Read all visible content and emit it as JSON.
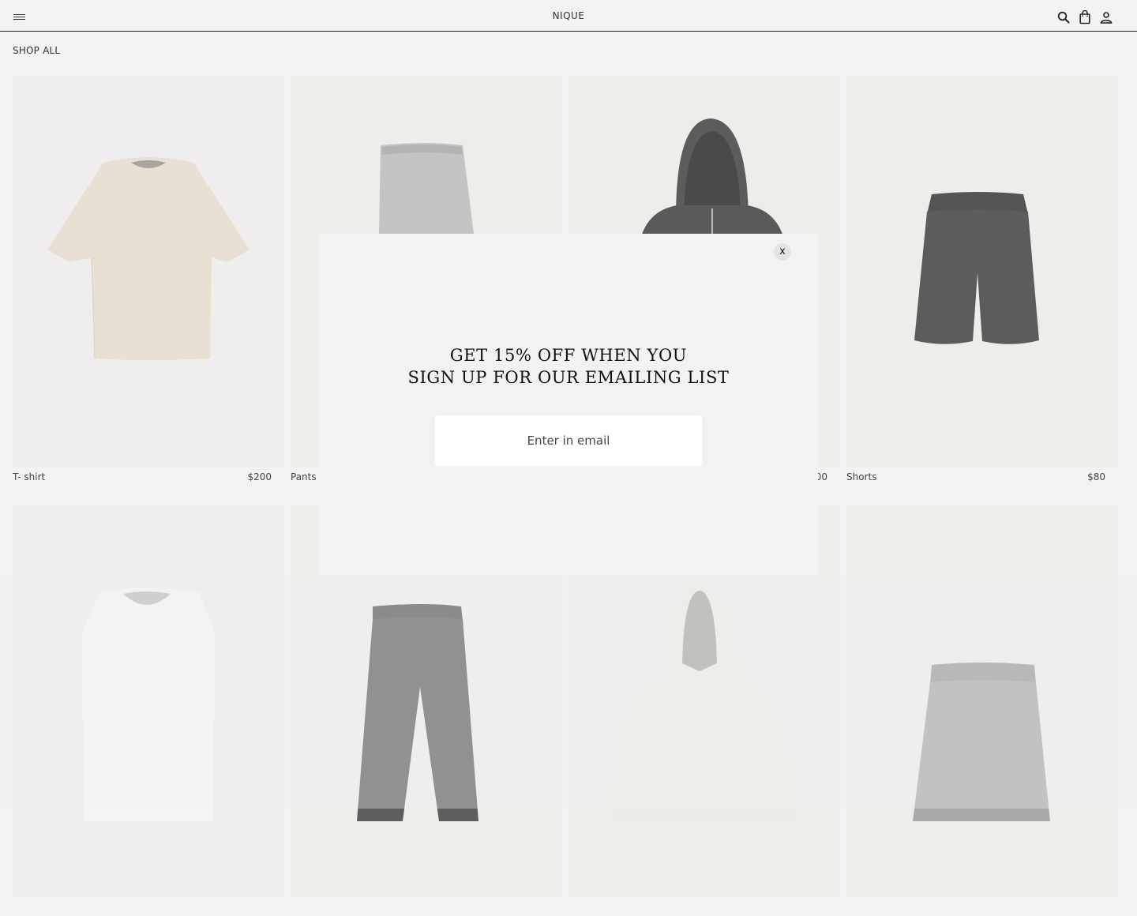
{
  "header": {
    "brand": "NIQUE",
    "menu_icon": "hamburger-menu-icon",
    "icons": [
      "search-icon",
      "shopping-bag-icon",
      "account-icon"
    ]
  },
  "breadcrumb": {
    "label": "SHOP ALL"
  },
  "products": [
    {
      "name": "T- shirt",
      "price": "$200",
      "bg": "#efeded",
      "color": "#e8e0d3"
    },
    {
      "name": "Pants",
      "price": "",
      "bg": "#eeedea",
      "color": "#c2c2c2"
    },
    {
      "name": "",
      "price": "00",
      "bg": "#eeedea",
      "color": "#5a5a5a"
    },
    {
      "name": "Shorts",
      "price": "$80",
      "bg": "#eeedea",
      "color": "#5c5c5c"
    },
    {
      "name": "",
      "price": "",
      "bg": "#efeded",
      "color": "#f3f3f3"
    },
    {
      "name": "",
      "price": "",
      "bg": "#eeedea",
      "color": "#5e5e5e"
    },
    {
      "name": "",
      "price": "",
      "bg": "#eeedea",
      "color": "#ecebe6"
    },
    {
      "name": "",
      "price": "",
      "bg": "#eeedea",
      "color": "#a9a9a9"
    }
  ],
  "modal": {
    "close_label": "x",
    "title": "GET 15% OFF WHEN YOU\nSIGN UP FOR OUR EMAILING LIST",
    "email_placeholder": "Enter in email"
  }
}
